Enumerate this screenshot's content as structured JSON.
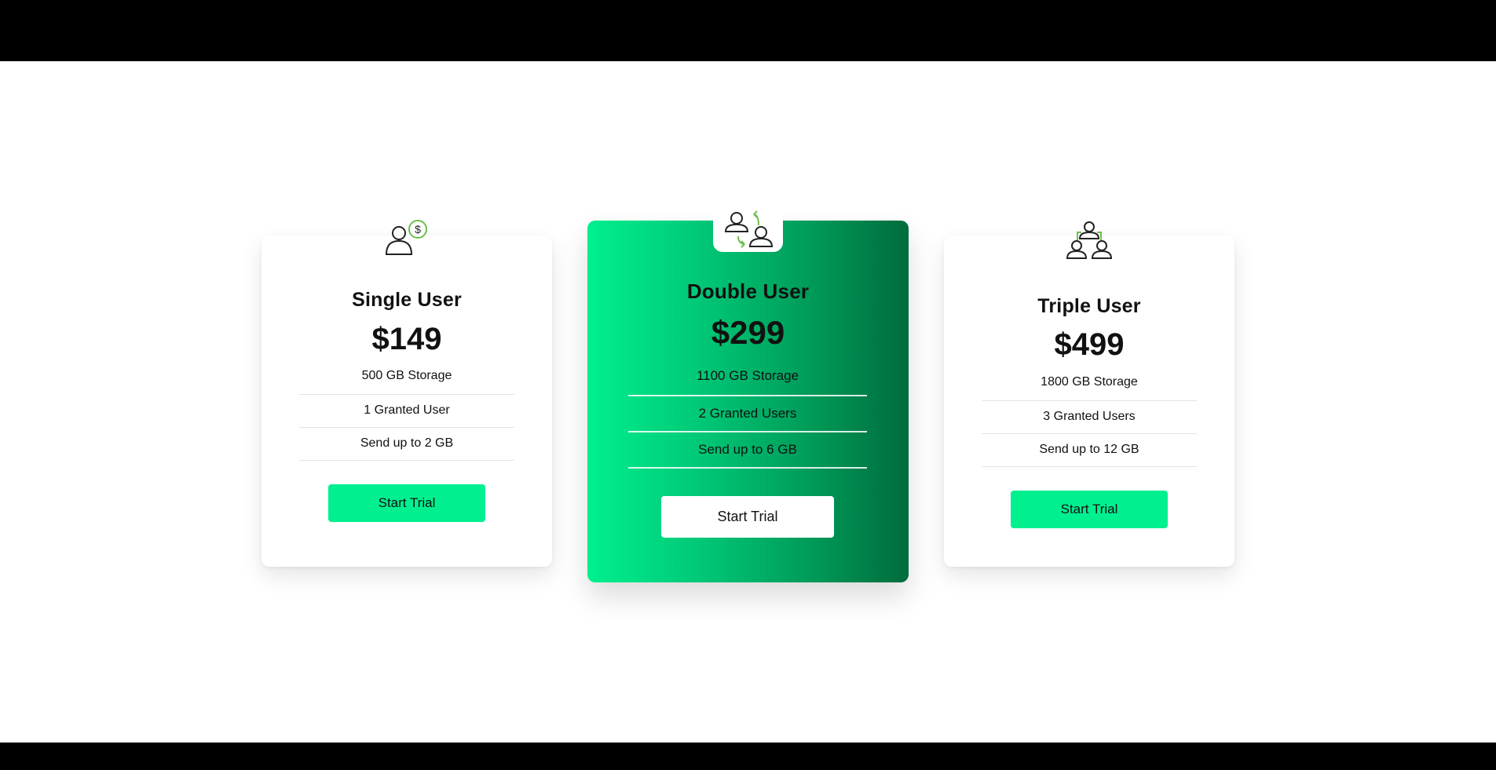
{
  "colors": {
    "accent": "#00f090",
    "icon_accent": "#6cc04a",
    "gradient_start": "#00f08f",
    "gradient_end": "#006b3c"
  },
  "plans": [
    {
      "icon": "user-dollar-icon",
      "name": "Single User",
      "price": "$149",
      "features": [
        "500 GB Storage",
        "1 Granted User",
        "Send up to 2 GB"
      ],
      "button_label": "Start Trial"
    },
    {
      "icon": "users-exchange-icon",
      "name": "Double User",
      "price": "$299",
      "features": [
        "1100 GB Storage",
        "2 Granted Users",
        "Send up to 6 GB"
      ],
      "button_label": "Start Trial"
    },
    {
      "icon": "users-group-icon",
      "name": "Triple User",
      "price": "$499",
      "features": [
        "1800 GB Storage",
        "3 Granted Users",
        "Send up to 12 GB"
      ],
      "button_label": "Start Trial"
    }
  ]
}
